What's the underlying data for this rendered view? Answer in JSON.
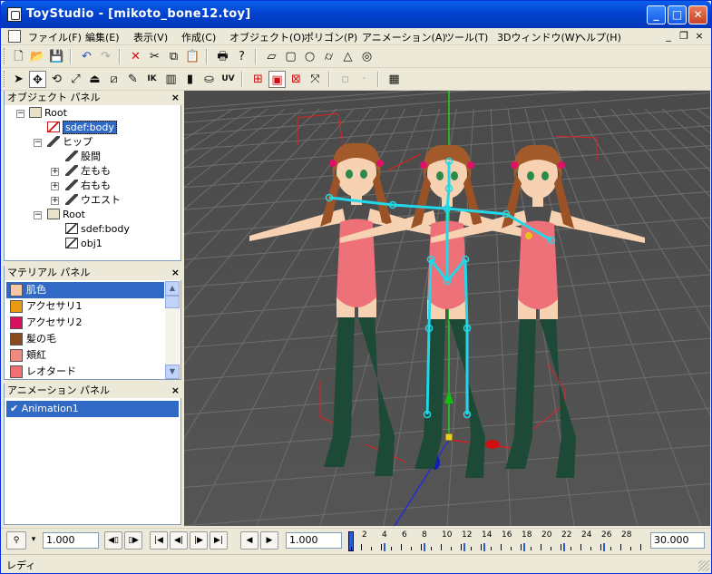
{
  "window": {
    "title": "ToyStudio - [mikoto_bone12.toy]"
  },
  "menu": {
    "items": [
      "ファイル(F)",
      "編集(E)",
      "表示(V)",
      "作成(C)",
      "オブジェクト(O)",
      "ポリゴン(P)",
      "アニメーション(A)",
      "ツール(T)",
      "3Dウィンドウ(W)",
      "ヘルプ(H)"
    ]
  },
  "toolbar2": {
    "ik_label": "IK",
    "uv_label": "UV"
  },
  "object_panel": {
    "title": "オブジェクト パネル",
    "items": [
      {
        "label": "Root",
        "icon": "folder-icon"
      },
      {
        "label": "sdef:body",
        "icon": "mesh-icon",
        "selected": true
      },
      {
        "label": "ヒップ",
        "icon": "bone-icon"
      },
      {
        "label": "股間",
        "icon": "bone-icon"
      },
      {
        "label": "左もも",
        "icon": "bone-icon"
      },
      {
        "label": "右もも",
        "icon": "bone-icon"
      },
      {
        "label": "ウエスト",
        "icon": "bone-icon"
      },
      {
        "label": "Root",
        "icon": "folder-icon"
      },
      {
        "label": "sdef:body",
        "icon": "mesh-icon"
      },
      {
        "label": "obj1",
        "icon": "mesh-icon"
      }
    ]
  },
  "material_panel": {
    "title": "マテリアル パネル",
    "items": [
      {
        "label": "肌色",
        "color": "#f7c7a8",
        "selected": true
      },
      {
        "label": "アクセサリ1",
        "color": "#e89a10"
      },
      {
        "label": "アクセサリ2",
        "color": "#d81060"
      },
      {
        "label": "髪の毛",
        "color": "#8a4a20"
      },
      {
        "label": "頬紅",
        "color": "#f08a80"
      },
      {
        "label": "レオタード",
        "color": "#ef6f72"
      }
    ]
  },
  "animation_panel": {
    "title": "アニメーション パネル",
    "items": [
      {
        "label": "Animation1",
        "checked": true
      }
    ]
  },
  "timeline": {
    "speed_value": "1.000",
    "frame_value": "1.000",
    "end_value": "30.000",
    "tick_labels": [
      "2",
      "4",
      "6",
      "8",
      "10",
      "12",
      "14",
      "16",
      "18",
      "20",
      "22",
      "24",
      "26",
      "28"
    ]
  },
  "status": {
    "text": "レディ"
  },
  "colors": {
    "titlebar": "#0343d0",
    "selection": "#316ac5",
    "viewport_bg": "#4d4d4d",
    "bone": "#22d8e8"
  }
}
